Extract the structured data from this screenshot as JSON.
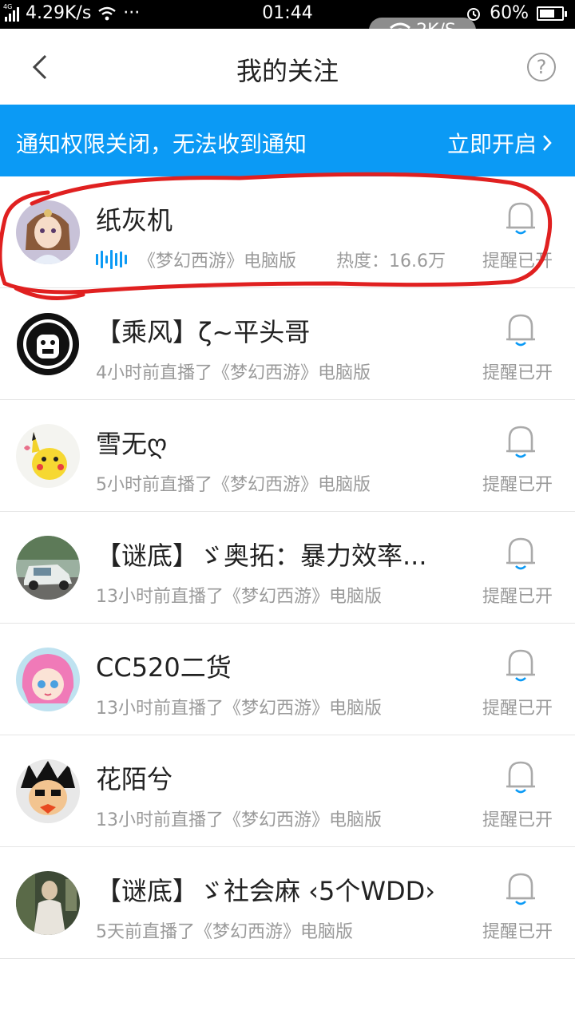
{
  "status_bar": {
    "network": "4G",
    "speed": "4.29K/s",
    "more": "···",
    "time": "01:44",
    "battery": "60%",
    "battery_level": 0.6,
    "overlay_speed": "2K/S"
  },
  "header": {
    "title": "我的关注",
    "help": "?"
  },
  "notice": {
    "text": "通知权限关闭，无法收到通知",
    "action": "立即开启"
  },
  "follows": [
    {
      "name": "纸灰机",
      "live_game": "《梦幻西游》电脑版",
      "heat": "热度：16.6万",
      "remind": "提醒已开",
      "avatar": "anime-girl"
    },
    {
      "name": "【乘风】ζ~平头哥",
      "status": "4小时前直播了《梦幻西游》电脑版",
      "remind": "提醒已开",
      "avatar": "black-bear"
    },
    {
      "name": "雪无ღ",
      "status": "5小时前直播了《梦幻西游》电脑版",
      "remind": "提醒已开",
      "avatar": "pikachu"
    },
    {
      "name": "【谜底】ゞ奥拓：暴力效率...",
      "status": "13小时前直播了《梦幻西游》电脑版",
      "remind": "提醒已开",
      "avatar": "car-photo"
    },
    {
      "name": "CC520二货",
      "status": "13小时前直播了《梦幻西游》电脑版",
      "remind": "提醒已开",
      "avatar": "pink-hair-girl"
    },
    {
      "name": "花陌兮",
      "status": "13小时前直播了《梦幻西游》电脑版",
      "remind": "提醒已开",
      "avatar": "cartoon-boy"
    },
    {
      "name": "【谜底】ゞ社会麻 ‹5个WDD›",
      "status": "5天前直播了《梦幻西游》电脑版",
      "remind": "提醒已开",
      "avatar": "person-photo"
    }
  ],
  "colors": {
    "accent": "#0b9af5",
    "annotation": "#e02020",
    "secondary_text": "#9a9a9a"
  }
}
